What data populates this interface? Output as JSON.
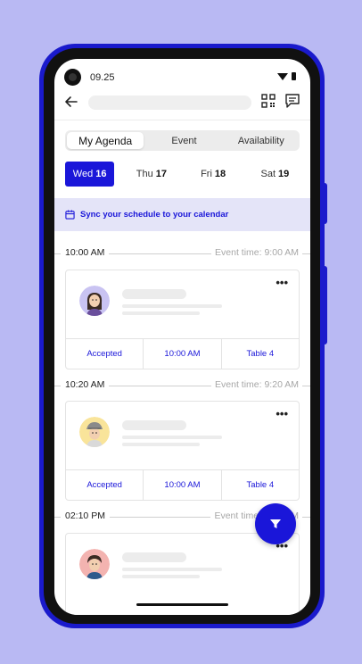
{
  "status": {
    "time": "09.25"
  },
  "tabs": [
    {
      "label": "My Agenda",
      "active": true
    },
    {
      "label": "Event",
      "active": false
    },
    {
      "label": "Availability",
      "active": false
    }
  ],
  "days": [
    {
      "weekday": "Wed",
      "date": "16",
      "active": true
    },
    {
      "weekday": "Thu",
      "date": "17",
      "active": false
    },
    {
      "weekday": "Fri",
      "date": "18",
      "active": false
    },
    {
      "weekday": "Sat",
      "date": "19",
      "active": false
    }
  ],
  "sync": {
    "label": "Sync your schedule to your calendar"
  },
  "agenda": [
    {
      "time": "10:00 AM",
      "event_time": "Event time: 9:00 AM",
      "status": "Accepted",
      "slot": "10:00 AM",
      "table": "Table 4"
    },
    {
      "time": "10:20 AM",
      "event_time": "Event time: 9:20 AM",
      "status": "Accepted",
      "slot": "10:00 AM",
      "table": "Table 4"
    },
    {
      "time": "02:10 PM",
      "event_time": "Event time: 2:10 PM",
      "status": "",
      "slot": "",
      "table": ""
    }
  ],
  "more_label": "•••",
  "colors": {
    "accent": "#1a16d9",
    "background": "#b9b9f3",
    "phone_frame": "#1a1acc"
  },
  "icons": [
    "back-arrow-icon",
    "qr-code-icon",
    "message-icon",
    "calendar-icon",
    "more-dots-icon",
    "filter-icon"
  ]
}
